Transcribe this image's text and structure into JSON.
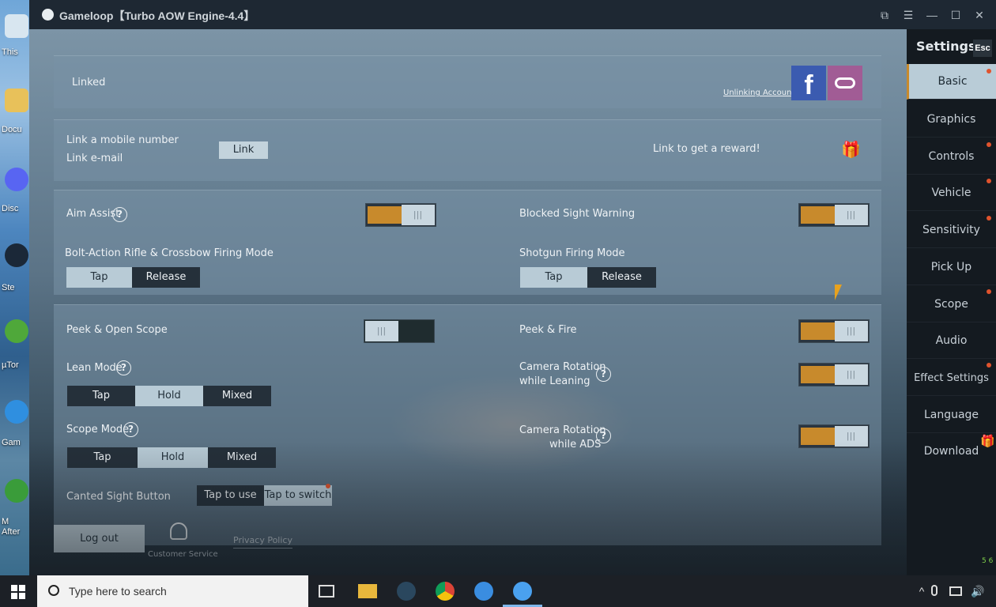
{
  "desktop": {
    "labels": [
      "This",
      "Docu",
      "Disc",
      "Ste",
      "µTor",
      "Gam",
      "M After"
    ]
  },
  "window": {
    "title": "Gameloop【Turbo AOW Engine-4.4】"
  },
  "account": {
    "linked_label": "Linked",
    "unlink_label": "Unlinking Accounts",
    "link_mobile_label": "Link a mobile number",
    "link_email_label": "Link e-mail",
    "link_button": "Link",
    "reward_label": "Link to get a reward!"
  },
  "settings_left": {
    "aim_assist": "Aim Assist",
    "bolt_action": "Bolt-Action Rifle & Crossbow Firing Mode",
    "bolt_options": [
      "Tap",
      "Release"
    ],
    "peek_open_scope": "Peek & Open Scope",
    "lean_mode": "Lean Mode",
    "lean_options": [
      "Tap",
      "Hold",
      "Mixed"
    ],
    "scope_mode": "Scope Mode",
    "scope_options": [
      "Tap",
      "Hold",
      "Mixed"
    ],
    "canted_sight": "Canted Sight Button",
    "canted_options": [
      "Tap to use",
      "Tap to switch"
    ]
  },
  "settings_right": {
    "blocked_sight": "Blocked Sight Warning",
    "shotgun_mode": "Shotgun Firing Mode",
    "shotgun_options": [
      "Tap",
      "Release"
    ],
    "peek_fire": "Peek & Fire",
    "cam_lean_1": "Camera Rotation",
    "cam_lean_2": "while Leaning",
    "cam_ads_1": "Camera Rotation",
    "cam_ads_2": "while ADS"
  },
  "toggles": {
    "aim_assist": true,
    "blocked_sight": true,
    "peek_open_scope": false,
    "peek_fire": true,
    "cam_lean": true,
    "cam_ads": true
  },
  "footer": {
    "logout": "Log out",
    "customer_service": "Customer Service",
    "privacy": "Privacy Policy"
  },
  "sidebar": {
    "title": "Settings",
    "esc": "Esc",
    "items": [
      "Basic",
      "Graphics",
      "Controls",
      "Vehicle",
      "Sensitivity",
      "Pick Up",
      "Scope",
      "Audio",
      "Effect Settings",
      "Language",
      "Download"
    ],
    "fps": "5 6"
  },
  "taskbar": {
    "search_placeholder": "Type here to search"
  },
  "colors": {
    "accent": "#c88a2c",
    "selected": "#b8cbd6",
    "badge": "#e0532d"
  }
}
